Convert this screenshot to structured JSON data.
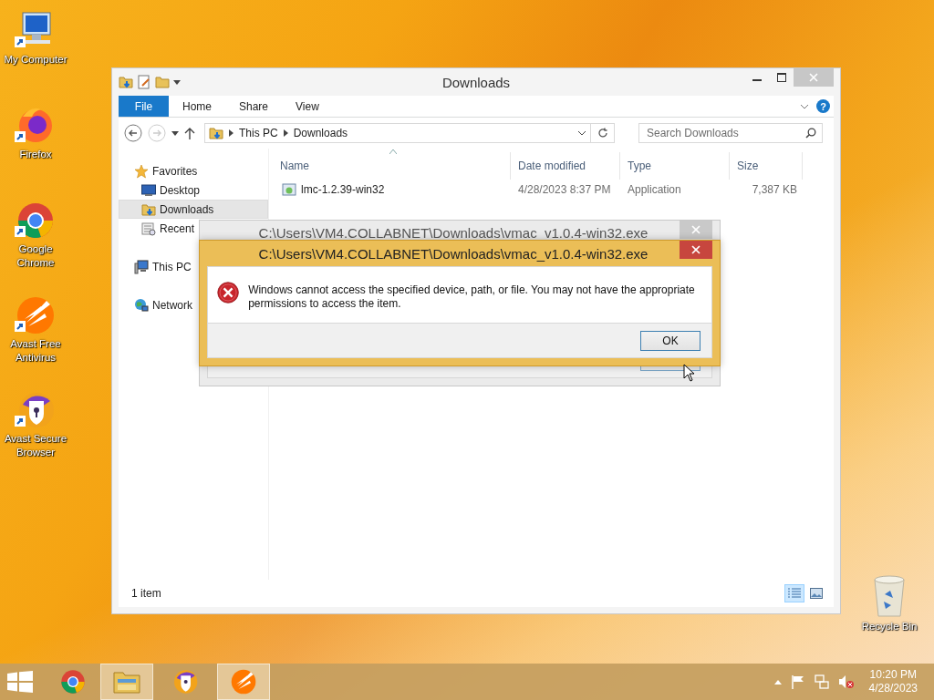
{
  "desktop_icons": [
    {
      "kind": "computer",
      "label": "My Computer"
    },
    {
      "kind": "firefox",
      "label": "Firefox"
    },
    {
      "kind": "chrome",
      "label": "Google Chrome"
    },
    {
      "kind": "avast_antivirus",
      "label": "Avast Free Antivirus"
    },
    {
      "kind": "avast_browser",
      "label": "Avast Secure Browser"
    }
  ],
  "recycle_bin": {
    "label": "Recycle Bin"
  },
  "explorer": {
    "title": "Downloads",
    "file_tab": "File",
    "ribbon_tabs": [
      "Home",
      "Share",
      "View"
    ],
    "help": "?",
    "address": [
      "This PC",
      "Downloads"
    ],
    "search": {
      "placeholder": "Search Downloads"
    },
    "nav": [
      {
        "kind": "favorites",
        "label": "Favorites",
        "selected": false,
        "children": [
          {
            "kind": "desktop",
            "label": "Desktop",
            "selected": false
          },
          {
            "kind": "downloads",
            "label": "Downloads",
            "selected": true
          },
          {
            "kind": "recent",
            "label": "Recent",
            "selected": false
          }
        ]
      },
      {
        "kind": "pc",
        "label": "This PC",
        "selected": false
      },
      {
        "kind": "network",
        "label": "Network",
        "selected": false
      }
    ],
    "columns": [
      "Name",
      "Date modified",
      "Type",
      "Size"
    ],
    "rows": [
      {
        "name": "lmc-1.2.39-win32",
        "date": "4/28/2023 8:37 PM",
        "type": "Application",
        "size": "7,387 KB",
        "selected": false
      }
    ],
    "status": "1 item",
    "view_buttons": [
      {
        "kind": "details",
        "selected": true
      },
      {
        "kind": "large_icons",
        "selected": false
      }
    ]
  },
  "dialogs": [
    {
      "title": "C:\\Users\\VM4.COLLABNET\\Downloads\\vmac_v1.0.4-win32.exe",
      "active": false
    },
    {
      "title": "C:\\Users\\VM4.COLLABNET\\Downloads\\vmac_v1.0.4-win32.exe",
      "active": true,
      "message": "Windows cannot access the specified device, path, or file. You may not have the appropriate permissions to access the item.",
      "button": "OK"
    }
  ],
  "taskbar": {
    "apps": [
      {
        "kind": "chrome",
        "active": false
      },
      {
        "kind": "explorer",
        "active": true
      },
      {
        "kind": "avast_browser",
        "active": false
      },
      {
        "kind": "avast_antivirus",
        "active": true
      }
    ],
    "clock": {
      "time": "10:20 PM",
      "date": "4/28/2023"
    }
  }
}
